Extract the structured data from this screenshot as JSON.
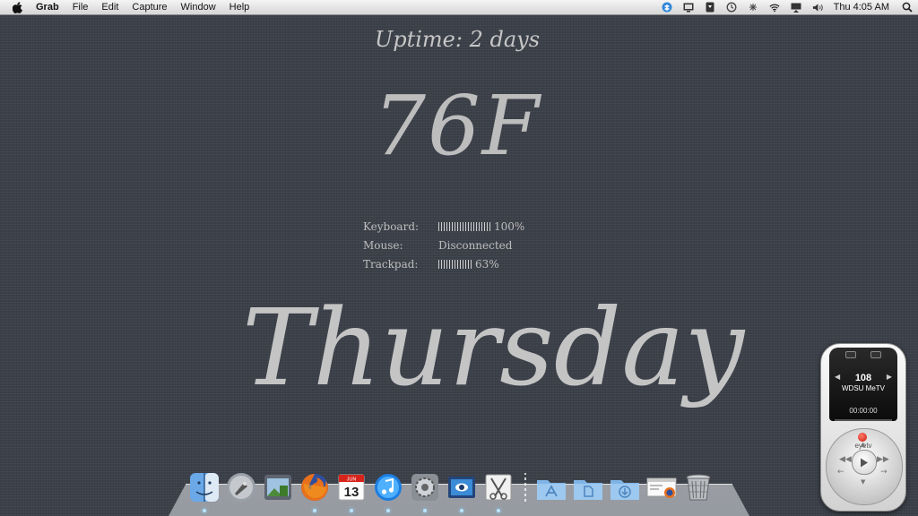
{
  "menubar": {
    "app_name": "Grab",
    "menus": [
      "File",
      "Edit",
      "Capture",
      "Window",
      "Help"
    ],
    "clock": "Thu 4:05 AM"
  },
  "widgets": {
    "uptime": "Uptime: 2 days",
    "temperature": "76F",
    "battery": [
      {
        "label": "Keyboard:",
        "value": "100%",
        "level": 1.0
      },
      {
        "label": "Mouse:",
        "value": "Disconnected",
        "level": null
      },
      {
        "label": "Trackpad:",
        "value": "63%",
        "level": 0.63
      }
    ],
    "weekday": "Thursday"
  },
  "dock": {
    "apps": [
      "finder-icon",
      "launchpad-icon",
      "preview-icon",
      "firefox-icon",
      "calendar-icon",
      "itunes-icon",
      "system-preferences-icon",
      "photo-icon",
      "grab-icon"
    ],
    "calendar": {
      "month": "JUN",
      "day": "13"
    },
    "folders": [
      "applications-folder-icon",
      "documents-folder-icon",
      "downloads-folder-icon",
      "web-page-document-icon",
      "trash-icon"
    ]
  },
  "eyetv": {
    "channel_number": "108",
    "channel_name": "WDSU MeTV",
    "time": "00:00:00",
    "logo": "eyetv",
    "progress": 0.0
  },
  "colors": {
    "desktop": "#3c4049",
    "widget_text": "#c4c4c4",
    "menubar": "#e6e6e6"
  }
}
